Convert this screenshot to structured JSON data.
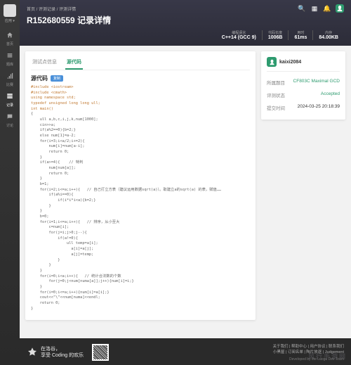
{
  "sidebar": {
    "user": "应用 ▾",
    "items": [
      {
        "icon": "home",
        "label": "首页"
      },
      {
        "icon": "list",
        "label": "题库"
      },
      {
        "icon": "signal",
        "label": "比赛"
      },
      {
        "icon": "chart",
        "label": "记录"
      },
      {
        "icon": "chat",
        "label": "讨论"
      }
    ]
  },
  "header": {
    "breadcrumb": [
      "首页",
      "评测记录",
      "评测详情"
    ],
    "title": "R152680559 记录详情",
    "stats": [
      {
        "k": "编程语言",
        "v": "C++14 (GCC 9)"
      },
      {
        "k": "代码长度",
        "v": "1006B"
      },
      {
        "k": "用时",
        "v": "61ms"
      },
      {
        "k": "内存",
        "v": "84.00KB"
      }
    ]
  },
  "tabs": [
    {
      "label": "测试点信息",
      "active": false
    },
    {
      "label": "源代码",
      "active": true
    }
  ],
  "source": {
    "heading": "源代码",
    "copy": "复制"
  },
  "code_pp": "#include <iostream>\n#include <cmath>\nusing namespace std;\ntypedef unsigned long long ull;\nint main()",
  "code_body": "{\n    ull a,b,c,i,j,k,num[1000];\n    cin>>a;\n    if(a%2==0){b=2;}\n    else num[1]=a-2;\n    for(i=3;i<a/2;i+=2){\n        num[i]=num[a-i];\n        return 0;\n    }\n    if(a>=4){    // 特判\n        num[num[a]];\n        return 0;\n    }\n    b=1;\n    for(i=2;i<=a;i++){   // 自己打立方表（建议运用数据sqrt(a)）。取建立a的sqrt(a) 的表，赋值……\n        if(a%i==0){\n            if(i*i*i<a){b=2;}\n        }\n    }\n    b=0;\n    for(i=1;i<=a;i++){   // 排序，从小至大\n        c=num[i];\n        for(j=i;j>0;j--){\n            if(a!=0){\n                ull temp=a[i];\n                  a[i]=a[j];\n                  a[j]=temp;\n            }\n        }\n    }\n    for(i=0;i<a;i++){   // 统计合法数的个数\n        for(j=0;j<num[numa[a]];j++){num[i]=i;}\n    }\n    for(i=0;i<=a;i++){num[i]=a[i];}\n    cout<<\"\\\"<<num[numa]<<endl;\n    return 0;\n}",
  "panel": {
    "author": "kaixi2084",
    "rows": [
      {
        "k": "所属题目",
        "v": "CF803C Maximal GCD",
        "link": true
      },
      {
        "k": "评测状态",
        "v": "Accepted",
        "link": true
      },
      {
        "k": "提交时间",
        "v": "2024-03-25 20:18:39",
        "link": false
      }
    ]
  },
  "footer": {
    "slogan1": "在洛谷，",
    "slogan2": "享受 Coding 的欢乐",
    "links": [
      "关于我们",
      "帮助中心",
      "用户协议",
      "联系我们"
    ],
    "sub": "小黑屋 | 订阅名单 | 陶片放逐 | Judgement",
    "dev": "Developed by the Luogu Dev Team"
  },
  "watermark": "风行手游网"
}
